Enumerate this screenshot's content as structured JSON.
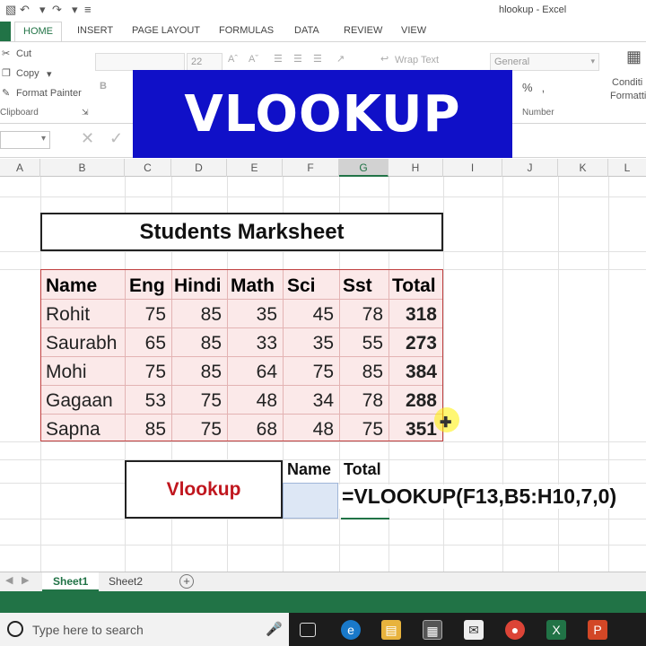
{
  "window": {
    "title": "hlookup - Excel"
  },
  "ribbon": {
    "tabs": [
      "HOME",
      "INSERT",
      "PAGE LAYOUT",
      "FORMULAS",
      "DATA",
      "REVIEW",
      "VIEW"
    ],
    "active_tab": "HOME",
    "clipboard": {
      "cut": "Cut",
      "copy": "Copy",
      "format_painter": "Format Painter",
      "group": "Clipboard"
    },
    "font": {
      "size": "22",
      "bold": "B"
    },
    "alignment": {
      "wrap_text": "Wrap Text"
    },
    "number": {
      "format": "General",
      "percent": "%",
      "group": "Number"
    },
    "styles": {
      "conditional_1": "Conditi",
      "conditional_2": "Formatti"
    }
  },
  "banner": {
    "text": "VLOOKUP"
  },
  "columns": [
    "A",
    "B",
    "C",
    "D",
    "E",
    "F",
    "G",
    "H",
    "I",
    "J",
    "K",
    "L"
  ],
  "selected_column": "G",
  "sheet": {
    "title": "Students Marksheet",
    "headers": [
      "Name",
      "Eng",
      "Hindi",
      "Math",
      "Sci",
      "Sst",
      "Total"
    ],
    "rows": [
      [
        "Rohit",
        "75",
        "85",
        "35",
        "45",
        "78",
        "318"
      ],
      [
        "Saurabh",
        "65",
        "85",
        "33",
        "35",
        "55",
        "273"
      ],
      [
        "Mohi",
        "75",
        "85",
        "64",
        "75",
        "85",
        "384"
      ],
      [
        "Gagaan",
        "53",
        "75",
        "48",
        "34",
        "78",
        "288"
      ],
      [
        "Sapna",
        "85",
        "75",
        "68",
        "48",
        "75",
        "351"
      ]
    ]
  },
  "lookup": {
    "label": "Vlookup",
    "name_header": "Name",
    "total_header": "Total",
    "formula": "=VLOOKUP(F13,B5:H10,7,0)"
  },
  "sheet_tabs": [
    "Sheet1",
    "Sheet2"
  ],
  "active_sheet": "Sheet1",
  "taskbar": {
    "search_placeholder": "Type here to search"
  },
  "colors": {
    "excel_green": "#217346",
    "banner_blue": "#1010c8",
    "vlookup_red": "#c0161e",
    "table_fill": "#fbe9e9"
  }
}
